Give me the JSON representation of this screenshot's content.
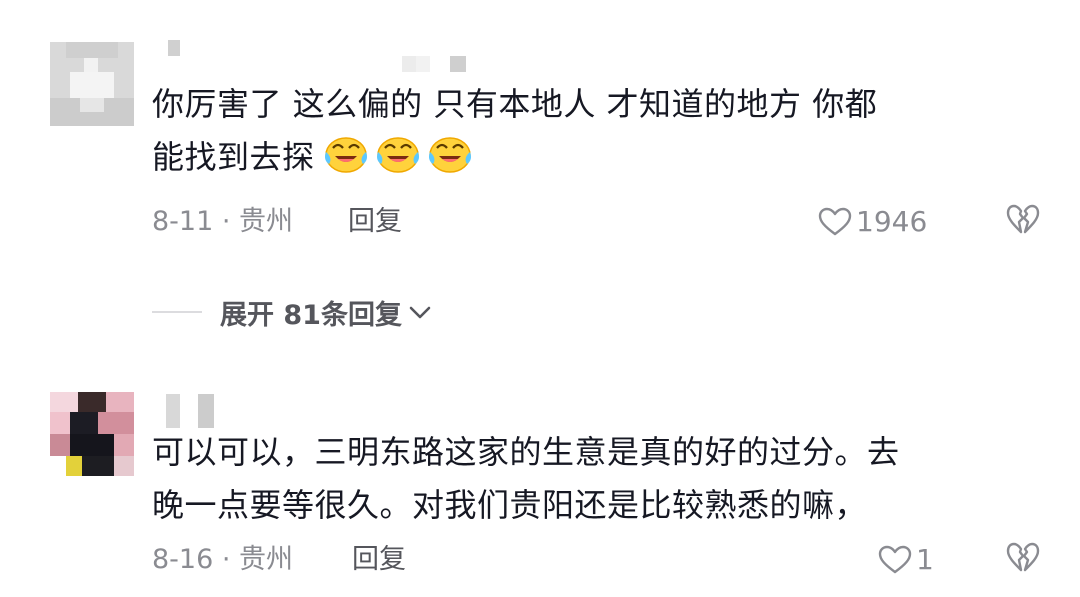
{
  "comments": [
    {
      "text_line1": "你厉害了   这么偏的 只有本地人 才知道的地方 你都",
      "text_line2": "能找到去探",
      "emojis": [
        "laugh-cry-icon",
        "laugh-cry-icon",
        "laugh-cry-icon"
      ],
      "date_location": "8-11 · 贵州",
      "reply_label": "回复",
      "like_count": "1946"
    },
    {
      "text_line1": "可以可以，三明东路这家的生意是真的好的过分。去",
      "text_line2": "晚一点要等很久。对我们贵阳还是比较熟悉的嘛，",
      "date_location": "8-16 · 贵州",
      "reply_label": "回复",
      "like_count": "1"
    }
  ],
  "expand_replies": {
    "label": "展开 81条回复"
  },
  "colors": {
    "text": "#161823",
    "meta": "#8a8b91",
    "reply": "#55565c"
  }
}
